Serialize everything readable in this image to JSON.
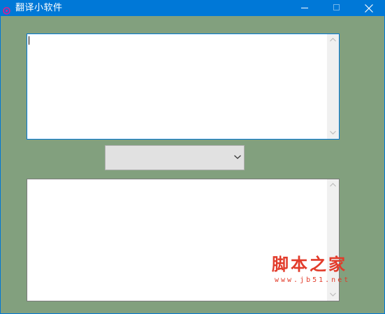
{
  "window": {
    "title": "翻译小软件",
    "icon": "app-flower-icon",
    "accent_color": "#0078d7",
    "client_background": "#82a07e"
  },
  "titlebar_buttons": {
    "minimize_icon": "minimize-icon",
    "maximize_icon": "maximize-icon",
    "close_icon": "close-icon"
  },
  "input_box": {
    "value": "",
    "has_focus": true
  },
  "language_select": {
    "selected": "",
    "icon": "chevron-down-icon"
  },
  "output_box": {
    "value": ""
  },
  "watermark": {
    "text": "脚本之家",
    "url": "www.jb51.net",
    "color": "#e23b2a"
  }
}
